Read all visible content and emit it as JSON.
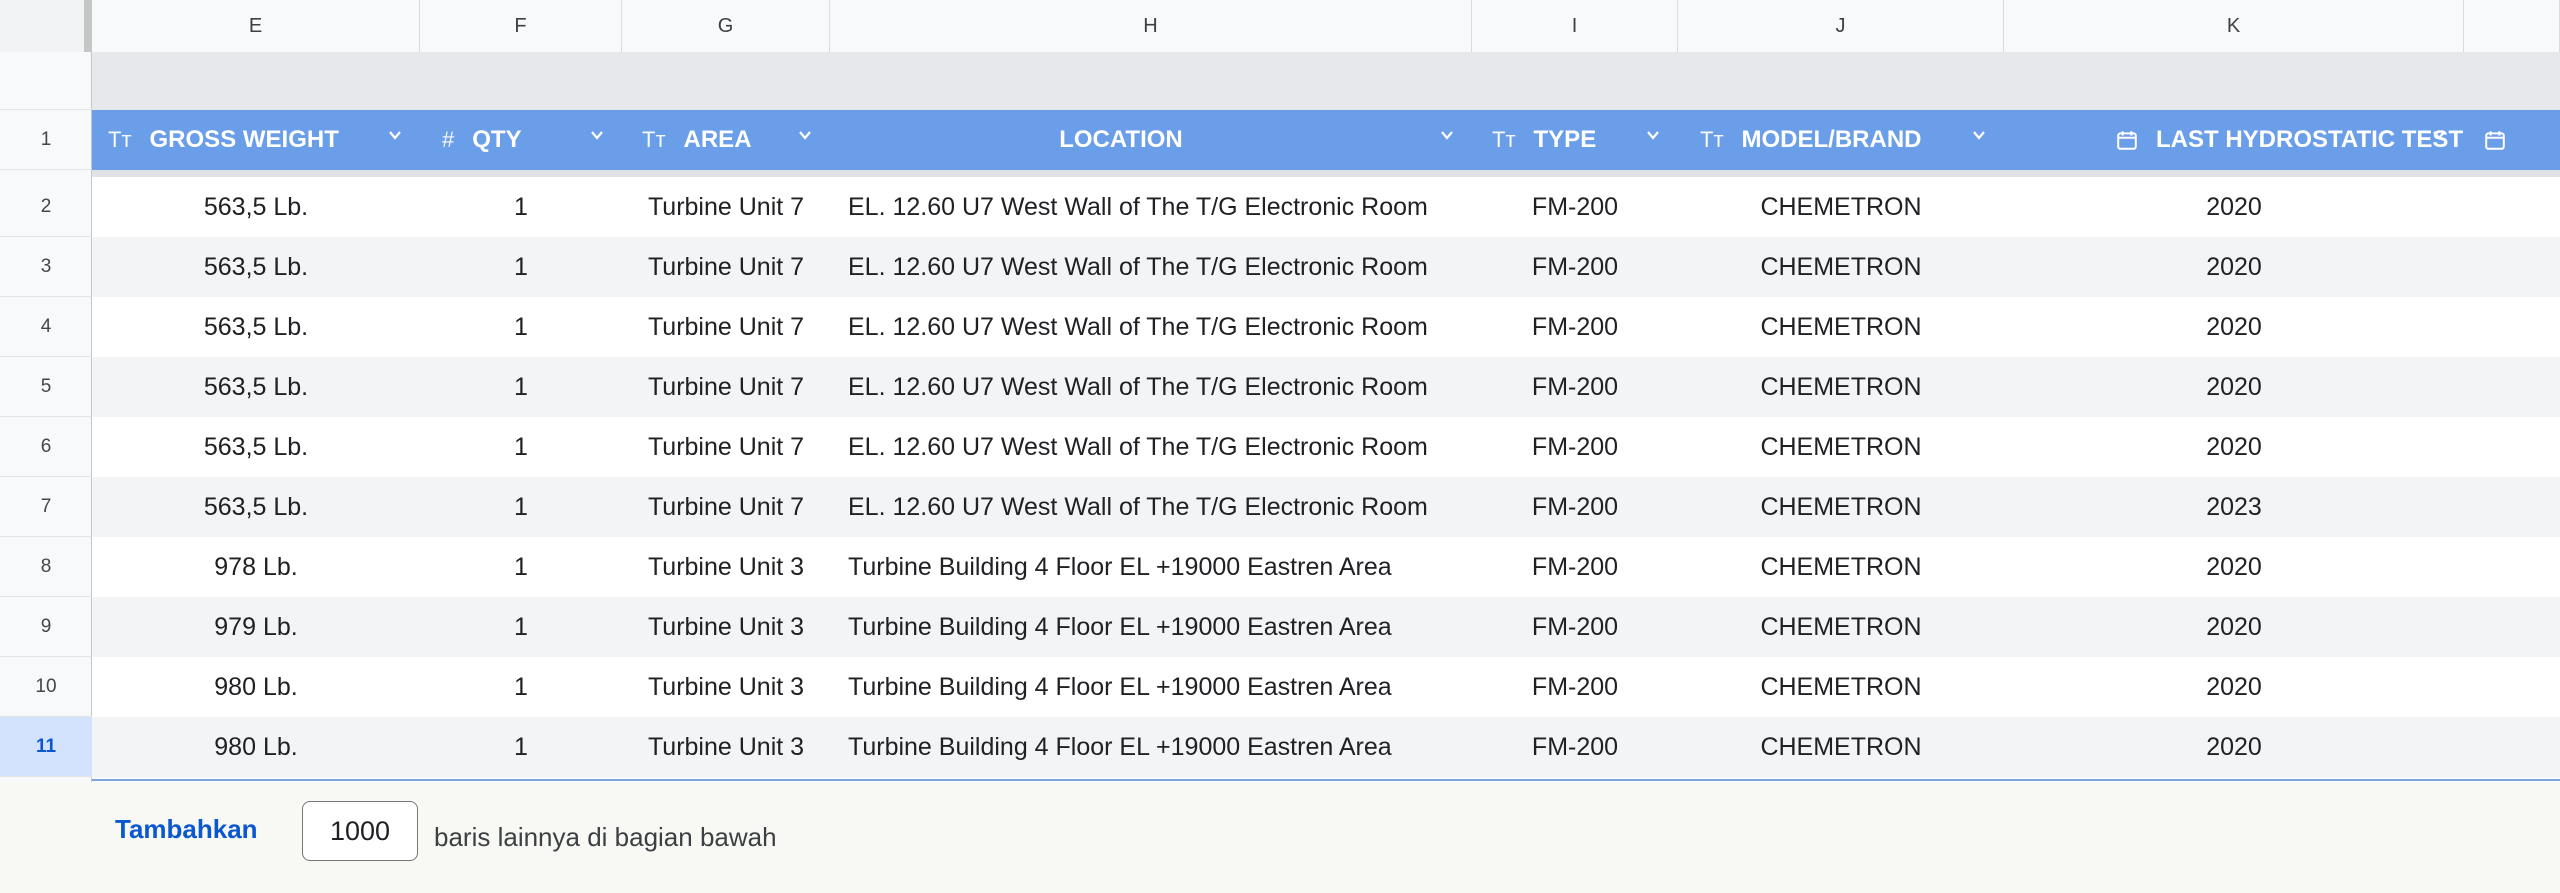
{
  "columns": [
    "E",
    "F",
    "G",
    "H",
    "I",
    "J",
    "K"
  ],
  "headers": {
    "gross_weight": "GROSS WEIGHT",
    "qty": "QTY",
    "area": "AREA",
    "location": "LOCATION",
    "type": "TYPE",
    "model_brand": "MODEL/BRAND",
    "last_hydrostatic_test": "LAST HYDROSTATIC TEST"
  },
  "header_icons": {
    "gross_weight": "text-type-icon",
    "qty": "number-type-icon",
    "area": "text-type-icon",
    "type": "text-type-icon",
    "model_brand": "text-type-icon",
    "last_hydrostatic_test": "calendar-icon",
    "next_column": "calendar-icon"
  },
  "header_row_number": "1",
  "rows": [
    {
      "num": "2",
      "gross_weight": "563,5 Lb.",
      "qty": "1",
      "area": "Turbine Unit 7",
      "location": "EL. 12.60 U7 West Wall of The T/G Electronic Room",
      "type": "FM-200",
      "model_brand": "CHEMETRON",
      "last_test": "2020"
    },
    {
      "num": "3",
      "gross_weight": "563,5 Lb.",
      "qty": "1",
      "area": "Turbine Unit 7",
      "location": "EL. 12.60 U7 West Wall of The T/G Electronic Room",
      "type": "FM-200",
      "model_brand": "CHEMETRON",
      "last_test": "2020"
    },
    {
      "num": "4",
      "gross_weight": "563,5 Lb.",
      "qty": "1",
      "area": "Turbine Unit 7",
      "location": "EL. 12.60 U7 West Wall of The T/G Electronic Room",
      "type": "FM-200",
      "model_brand": "CHEMETRON",
      "last_test": "2020"
    },
    {
      "num": "5",
      "gross_weight": "563,5 Lb.",
      "qty": "1",
      "area": "Turbine Unit 7",
      "location": "EL. 12.60 U7 West Wall of The T/G Electronic Room",
      "type": "FM-200",
      "model_brand": "CHEMETRON",
      "last_test": "2020"
    },
    {
      "num": "6",
      "gross_weight": "563,5 Lb.",
      "qty": "1",
      "area": "Turbine Unit 7",
      "location": "EL. 12.60 U7 West Wall of The T/G Electronic Room",
      "type": "FM-200",
      "model_brand": "CHEMETRON",
      "last_test": "2020"
    },
    {
      "num": "7",
      "gross_weight": "563,5 Lb.",
      "qty": "1",
      "area": "Turbine Unit 7",
      "location": "EL. 12.60 U7 West Wall of The T/G Electronic Room",
      "type": "FM-200",
      "model_brand": "CHEMETRON",
      "last_test": "2023"
    },
    {
      "num": "8",
      "gross_weight": "978 Lb.",
      "qty": "1",
      "area": "Turbine Unit 3",
      "location": "Turbine Building 4 Floor EL +19000 Eastren Area",
      "type": "FM-200",
      "model_brand": "CHEMETRON",
      "last_test": "2020"
    },
    {
      "num": "9",
      "gross_weight": "979 Lb.",
      "qty": "1",
      "area": "Turbine Unit 3",
      "location": "Turbine Building 4 Floor EL +19000 Eastren Area",
      "type": "FM-200",
      "model_brand": "CHEMETRON",
      "last_test": "2020"
    },
    {
      "num": "10",
      "gross_weight": "980 Lb.",
      "qty": "1",
      "area": "Turbine Unit 3",
      "location": "Turbine Building 4 Floor EL +19000 Eastren Area",
      "type": "FM-200",
      "model_brand": "CHEMETRON",
      "last_test": "2020"
    },
    {
      "num": "11",
      "gross_weight": "980 Lb.",
      "qty": "1",
      "area": "Turbine Unit 3",
      "location": "Turbine Building 4 Floor EL +19000 Eastren Area",
      "type": "FM-200",
      "model_brand": "CHEMETRON",
      "last_test": "2020"
    }
  ],
  "active_row": "11",
  "footer": {
    "add_label": "Tambahkan",
    "add_count": "1000",
    "add_suffix": "baris lainnya di bagian bawah"
  },
  "colors": {
    "header_bg": "#6b9ee8",
    "header_text": "#ffffff",
    "active_row_bg": "#d3e3fd",
    "link": "#0b57d0"
  }
}
